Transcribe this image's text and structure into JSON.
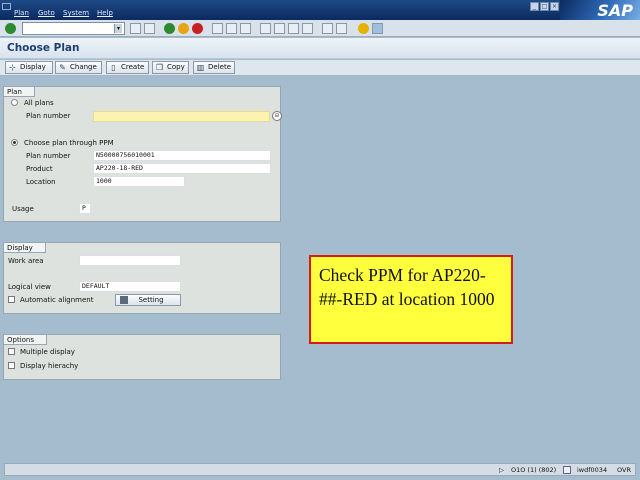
{
  "menubar": {
    "items": [
      "Plan",
      "Goto",
      "System",
      "Help"
    ],
    "logo": "SAP"
  },
  "toolbar": {
    "command_value": "",
    "icons": [
      "enter-icon",
      "save-icon",
      "back-icon",
      "exit-icon",
      "cancel-icon",
      "print-icon",
      "find-icon",
      "find-next-icon",
      "first-page-icon",
      "prev-page-icon",
      "next-page-icon",
      "last-page-icon",
      "new-session-icon",
      "shortcut-icon",
      "help-icon",
      "layout-icon"
    ]
  },
  "title": "Choose Plan",
  "app_toolbar": {
    "buttons": [
      {
        "label": "Display",
        "icon": "display-icon"
      },
      {
        "label": "Change",
        "icon": "pencil-icon"
      },
      {
        "label": "Create",
        "icon": "create-icon"
      },
      {
        "label": "Copy",
        "icon": "copy-icon"
      },
      {
        "label": "Delete",
        "icon": "trash-icon"
      }
    ]
  },
  "plan_group": {
    "title": "Plan",
    "all_plans_label": "All plans",
    "plan_number_label": "Plan number",
    "plan_number_value": "",
    "ppm_label": "Choose plan through PPM",
    "ppm_plan_number_label": "Plan number",
    "ppm_plan_number_value": "N50000756010001",
    "product_label": "Product",
    "product_value": "AP220-18-RED",
    "location_label": "Location",
    "location_value": "1000",
    "usage_label": "Usage",
    "usage_value": "P",
    "selected": "ppm"
  },
  "display_group": {
    "title": "Display",
    "work_area_label": "Work area",
    "work_area_value": "",
    "logical_view_label": "Logical view",
    "logical_view_value": "DEFAULT",
    "auto_align_label": "Automatic alignment",
    "setting_label": "Setting"
  },
  "options_group": {
    "title": "Options",
    "multiple_display_label": "Multiple display",
    "display_hierachy_label": "Display hierachy"
  },
  "callout": {
    "text": "Check PPM for AP220-##-RED at location 1000"
  },
  "status": {
    "system": "O1O (1) (802)",
    "server": "iwdf0034",
    "mode": "OVR"
  },
  "colors": {
    "background": "#a5bccf",
    "menubar": "#0b2a60",
    "callout_fill": "#ffff3e",
    "callout_border": "#d71a1a",
    "required_field": "#fdf3b0"
  }
}
